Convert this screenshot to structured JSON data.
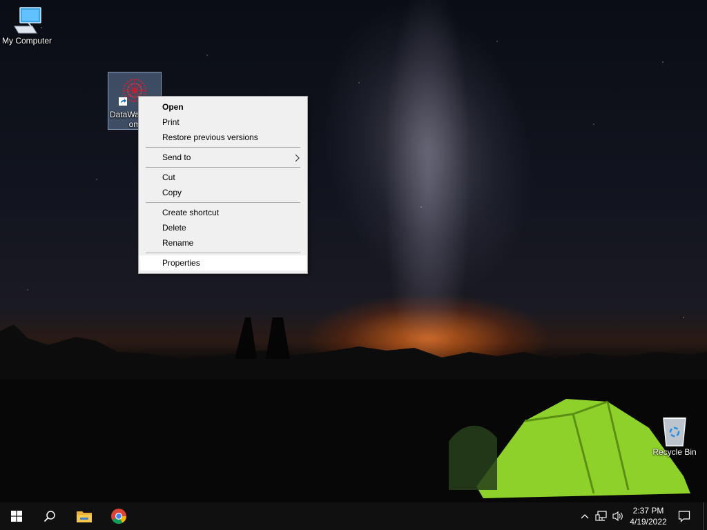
{
  "desktop": {
    "icons": {
      "my_computer": "My Computer",
      "datawave_line1": "DataWa",
      "datawave_line2": "om",
      "recycle_bin": "Recycle Bin"
    }
  },
  "context_menu": {
    "open": "Open",
    "print": "Print",
    "restore": "Restore previous versions",
    "send_to": "Send to",
    "cut": "Cut",
    "copy": "Copy",
    "create_shortcut": "Create shortcut",
    "delete": "Delete",
    "rename": "Rename",
    "properties": "Properties"
  },
  "taskbar": {
    "time": "2:37 PM",
    "date": "4/19/2022"
  },
  "colors": {
    "taskbar_bg": "#101010",
    "menu_bg": "#f0f0f0",
    "menu_hover": "#ffffff",
    "windows_blue": "#ffffff"
  }
}
